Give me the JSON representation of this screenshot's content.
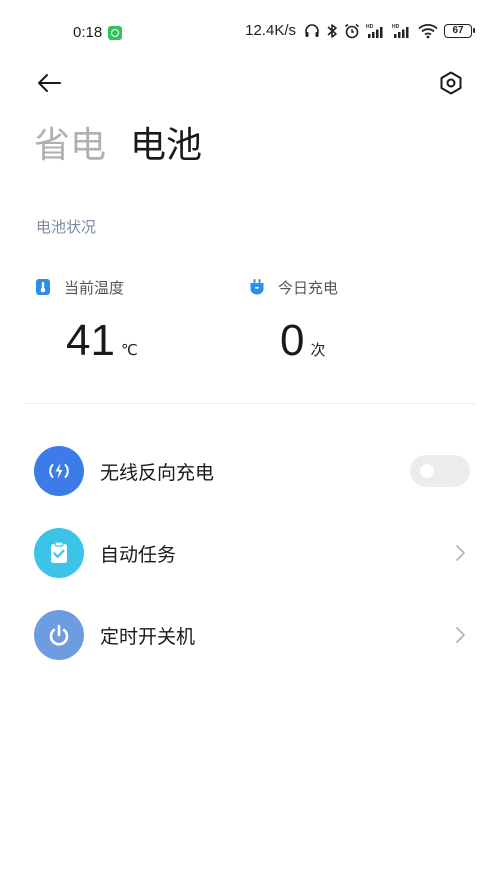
{
  "status_bar": {
    "time": "0:18",
    "network_speed": "12.4K/s",
    "battery_level": "67",
    "icons": [
      "headset-icon",
      "bluetooth-icon",
      "alarm-icon",
      "signal-hd-icon",
      "signal-hd-icon",
      "wifi-icon",
      "battery-icon"
    ]
  },
  "header": {
    "back_icon": "arrow-left-icon",
    "settings_icon": "settings-hexagon-icon",
    "tabs": [
      {
        "label": "省电",
        "active": false
      },
      {
        "label": "电池",
        "active": true
      }
    ]
  },
  "battery_status": {
    "section_title": "电池状况",
    "temperature": {
      "label": "当前温度",
      "value": "41",
      "unit": "℃",
      "icon": "thermometer-icon"
    },
    "charges_today": {
      "label": "今日充电",
      "value": "0",
      "unit": "次",
      "icon": "plug-icon"
    }
  },
  "options": [
    {
      "label": "无线反向充电",
      "icon": "wireless-charging-icon",
      "icon_color": "#3d7be8",
      "control": "toggle",
      "enabled": false
    },
    {
      "label": "自动任务",
      "icon": "clipboard-check-icon",
      "icon_color": "#3cc4e8",
      "control": "chevron"
    },
    {
      "label": "定时开关机",
      "icon": "power-icon",
      "icon_color": "#6e9ce0",
      "control": "chevron"
    }
  ],
  "colors": {
    "accent_blue": "#2b8fe8",
    "section_label": "#7c8aa6",
    "inactive_tab": "#b0b0b0"
  }
}
